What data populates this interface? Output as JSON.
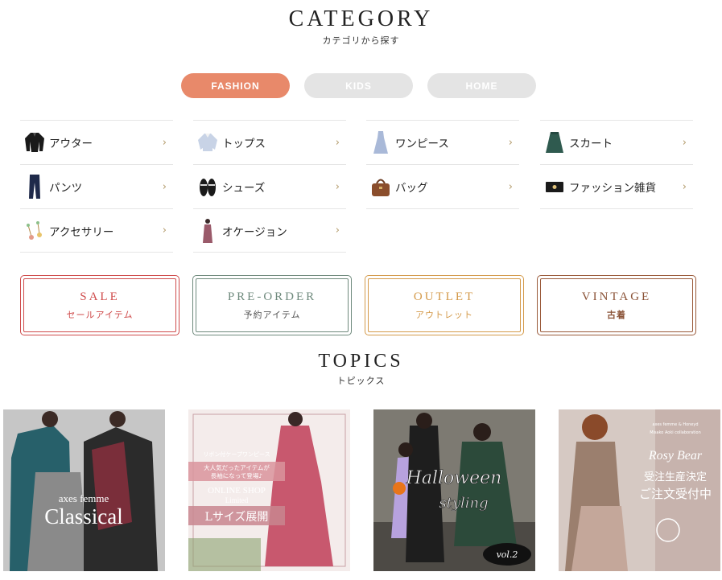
{
  "category": {
    "title": "CATEGORY",
    "subtitle": "カテゴリから探す"
  },
  "tabs": [
    {
      "label": "FASHION",
      "active": true,
      "color": "#e8896a"
    },
    {
      "label": "KIDS",
      "active": false,
      "color": "#e4e4e4"
    },
    {
      "label": "HOME",
      "active": false,
      "color": "#e4e4e4"
    }
  ],
  "categories": [
    {
      "label": "アウター",
      "icon": "outer-icon"
    },
    {
      "label": "トップス",
      "icon": "tops-icon"
    },
    {
      "label": "ワンピース",
      "icon": "onepiece-icon"
    },
    {
      "label": "スカート",
      "icon": "skirt-icon"
    },
    {
      "label": "パンツ",
      "icon": "pants-icon"
    },
    {
      "label": "シューズ",
      "icon": "shoes-icon"
    },
    {
      "label": "バッグ",
      "icon": "bag-icon"
    },
    {
      "label": "ファッション雑貨",
      "icon": "accessory-goods-icon"
    },
    {
      "label": "アクセサリー",
      "icon": "accessory-icon"
    },
    {
      "label": "オケージョン",
      "icon": "occasion-icon"
    }
  ],
  "chevron": "›",
  "promos": [
    {
      "en": "SALE",
      "ja": "セールアイテム",
      "color": "#cf4b4b"
    },
    {
      "en": "PRE-ORDER",
      "ja": "予約アイテム",
      "color": "#6f8a7d"
    },
    {
      "en": "OUTLET",
      "ja": "アウトレット",
      "color": "#d49a4a"
    },
    {
      "en": "VINTAGE",
      "ja": "古着",
      "color": "#9a5a3a"
    }
  ],
  "topics": {
    "title": "TOPICS",
    "subtitle": "トピックス"
  },
  "topic_items": [
    {
      "brand": "axes femme",
      "title": "Classical"
    },
    {
      "line1": "リボン付ケープワンピース",
      "line2": "大人気だったアイテムが",
      "line3": "長袖になって登場♪",
      "line4": "ONLINE SHOP",
      "line5": "Limited",
      "line6": "Lサイズ展開"
    },
    {
      "title1": "Halloween",
      "title2": "styling",
      "badge": "vol.2"
    },
    {
      "line1": "axes femme & Honeyd",
      "line2": "Misako Aoki collaboration",
      "title": "Rosy Bear",
      "line3": "受注生産決定",
      "line4": "ご注文受付中"
    }
  ]
}
